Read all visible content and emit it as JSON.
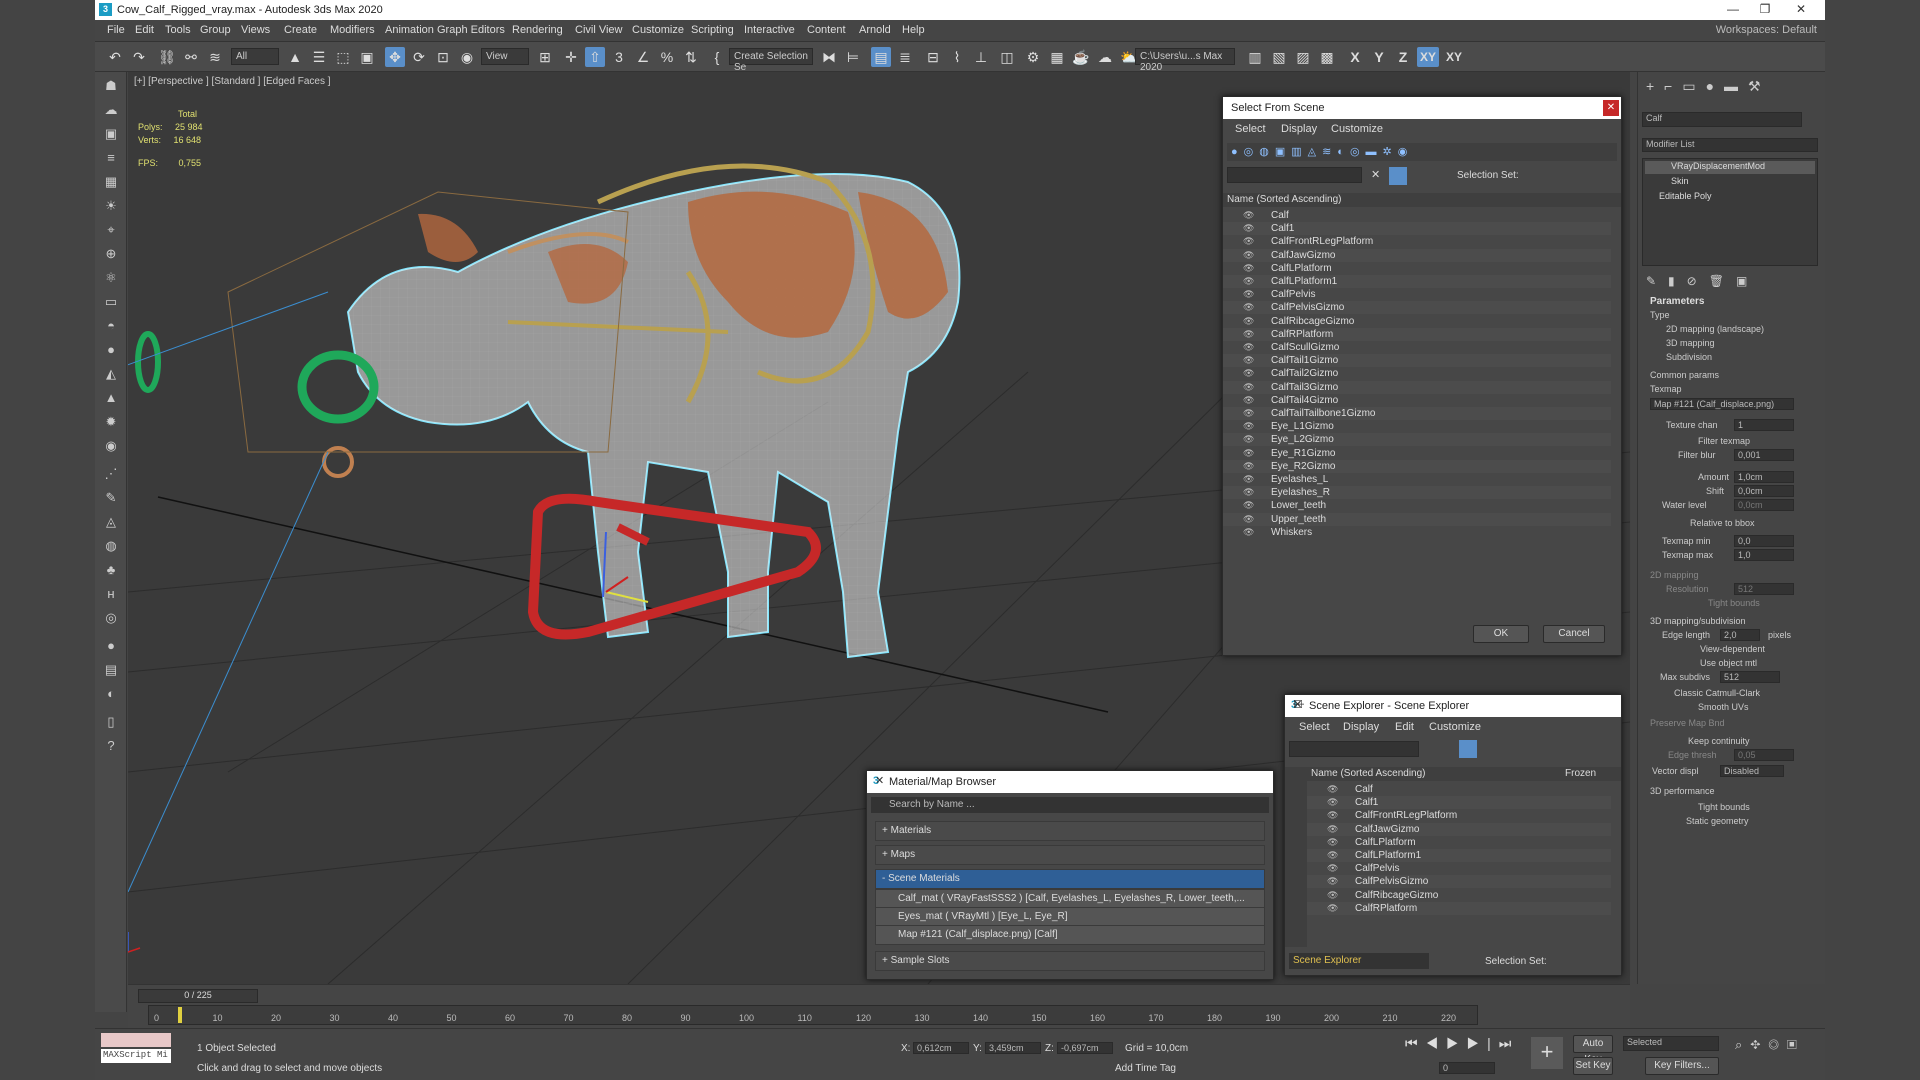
{
  "title": "Cow_Calf_Rigged_vray.max - Autodesk 3ds Max 2020",
  "menu": [
    "File",
    "Edit",
    "Tools",
    "Group",
    "Views",
    "Create",
    "Modifiers",
    "Animation",
    "Graph Editors",
    "Rendering",
    "Civil View",
    "Customize",
    "Scripting",
    "Interactive",
    "Content",
    "Arnold",
    "Help"
  ],
  "workspace": "Workspaces:  Default",
  "toolbar": {
    "filter": "All",
    "view": "View",
    "selset": "Create Selection Se",
    "path": "C:\\Users\\u...s Max 2020",
    "axes": [
      "X",
      "Y",
      "Z",
      "XY",
      "XY"
    ]
  },
  "viewport": {
    "label": "[+] [Perspective ] [Standard ] [Edged Faces ]",
    "stats": {
      "total": "Total",
      "polys_label": "Polys:",
      "polys": "25 984",
      "verts_label": "Verts:",
      "verts": "16 648",
      "fps_label": "FPS:",
      "fps": "0,755"
    }
  },
  "select_from_scene": {
    "title": "Select From Scene",
    "menu": [
      "Select",
      "Display",
      "Customize"
    ],
    "selset_label": "Selection Set:",
    "column": "Name (Sorted Ascending)",
    "items": [
      "Calf",
      "Calf1",
      "CalfFrontRLegPlatform",
      "CalfJawGizmo",
      "CalfLPlatform",
      "CalfLPlatform1",
      "CalfPelvis",
      "CalfPelvisGizmo",
      "CalfRibcageGizmo",
      "CalfRPlatform",
      "CalfScullGizmo",
      "CalfTail1Gizmo",
      "CalfTail2Gizmo",
      "CalfTail3Gizmo",
      "CalfTail4Gizmo",
      "CalfTailTailbone1Gizmo",
      "Eye_L1Gizmo",
      "Eye_L2Gizmo",
      "Eye_R1Gizmo",
      "Eye_R2Gizmo",
      "Eyelashes_L",
      "Eyelashes_R",
      "Lower_teeth",
      "Upper_teeth",
      "Whiskers"
    ],
    "ok": "OK",
    "cancel": "Cancel"
  },
  "scene_explorer": {
    "title": "Scene Explorer - Scene Explorer",
    "menu": [
      "Select",
      "Display",
      "Edit",
      "Customize"
    ],
    "column": "Name (Sorted Ascending)",
    "frozen": "Frozen",
    "items": [
      "Calf",
      "Calf1",
      "CalfFrontRLegPlatform",
      "CalfJawGizmo",
      "CalfLPlatform",
      "CalfLPlatform1",
      "CalfPelvis",
      "CalfPelvisGizmo",
      "CalfRibcageGizmo",
      "CalfRPlatform"
    ],
    "footer": "Scene Explorer",
    "selset_label": "Selection Set:"
  },
  "material_browser": {
    "title": "Material/Map Browser",
    "search": "Search by Name ...",
    "sections": [
      "+ Materials",
      "+ Maps",
      "- Scene Materials"
    ],
    "rows": [
      "Calf_mat  ( VRayFastSSS2 )  [Calf, Eyelashes_L, Eyelashes_R, Lower_teeth,...",
      "Eyes_mat  ( VRayMtl )  [Eye_L, Eye_R]",
      "Map #121 (Calf_displace.png) [Calf]"
    ],
    "sample": "+ Sample Slots"
  },
  "command_panel": {
    "object": "Calf",
    "modlist": "Modifier List",
    "stack": [
      "VRayDisplacementMod",
      "Skin",
      "Editable Poly"
    ],
    "parameters": "Parameters",
    "type": "Type",
    "types": [
      "2D mapping (landscape)",
      "3D mapping",
      "Subdivision"
    ],
    "common": "Common params",
    "texmap": "Texmap",
    "texmap_val": "Map #121 (Calf_displace.png)",
    "fields": [
      [
        "Texture chan",
        "1"
      ],
      [
        "Filter blur",
        "0,001"
      ],
      [
        "Amount",
        "1,0cm"
      ],
      [
        "Shift",
        "0,0cm"
      ],
      [
        "Water level",
        "0,0cm"
      ],
      [
        "Texmap min",
        "0,0"
      ],
      [
        "Texmap max",
        "1,0"
      ]
    ],
    "filter_texmap": "Filter texmap",
    "relative": "Relative to bbox",
    "mapping2d": "2D mapping",
    "resolution": "Resolution",
    "res_val": "512",
    "tight": "Tight bounds",
    "mapping3d": "3D mapping/subdivision",
    "edge_len": "Edge length",
    "edge_val": "2,0",
    "pixels": "pixels",
    "view_dep": "View-dependent",
    "use_obj": "Use object mtl",
    "max_subdivs": "Max subdivs",
    "max_val": "512",
    "catmull": "Classic Catmull-Clark",
    "smooth": "Smooth UVs",
    "preserve": "Preserve Map Bnd",
    "keep": "Keep continuity",
    "edge_thresh": "Edge thresh",
    "edge_thresh_val": "0,05",
    "vector": "Vector displ",
    "vector_val": "Disabled",
    "perf": "3D performance",
    "tight2": "Tight bounds",
    "static": "Static geometry"
  },
  "timeline": {
    "frame": "0 / 225",
    "ticks": [
      "0",
      "10",
      "20",
      "30",
      "40",
      "50",
      "60",
      "70",
      "80",
      "90",
      "100",
      "110",
      "120",
      "130",
      "140",
      "150",
      "160",
      "170",
      "180",
      "190",
      "200",
      "210",
      "220"
    ]
  },
  "status": {
    "maxscript": "MAXScript Mi",
    "selected": "1 Object Selected",
    "prompt": "Click and drag to select and move objects",
    "x_label": "X:",
    "x": "0,612cm",
    "y_label": "Y:",
    "y": "3,459cm",
    "z_label": "Z:",
    "z": "-0,697cm",
    "grid": "Grid = 10,0cm",
    "add_tag": "Add Time Tag",
    "autokey": "Auto Key",
    "setkey": "Set Key",
    "selected_dd": "Selected",
    "keyfilters": "Key Filters...",
    "frame": "0"
  }
}
